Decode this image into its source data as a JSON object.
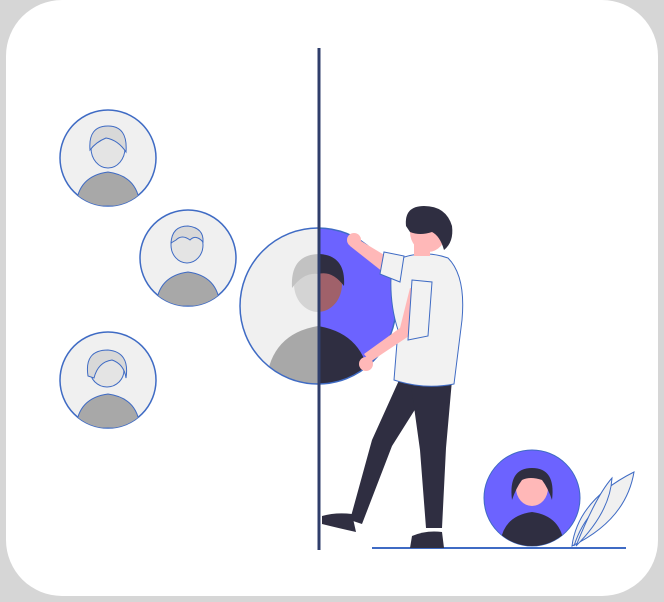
{
  "colors": {
    "background": "#d6d6d6",
    "card": "#ffffff",
    "accent": "#6c63ff",
    "avatar_fill": "#f0f0f0",
    "avatar_stroke": "#3f6bc4",
    "person_gray": "#a8a8a8",
    "dark": "#2f2e41",
    "skin": "#ffb8b8",
    "shirt": "#f2f2f2",
    "divider": "#2f3e6b"
  },
  "icons": {
    "avatar_woman_top": "user-avatar-icon",
    "avatar_man_middle": "user-avatar-icon",
    "avatar_woman_bottom": "user-avatar-icon",
    "avatar_large_split": "user-avatar-icon",
    "avatar_small_purple": "user-avatar-icon",
    "plant": "leaf-icon"
  }
}
